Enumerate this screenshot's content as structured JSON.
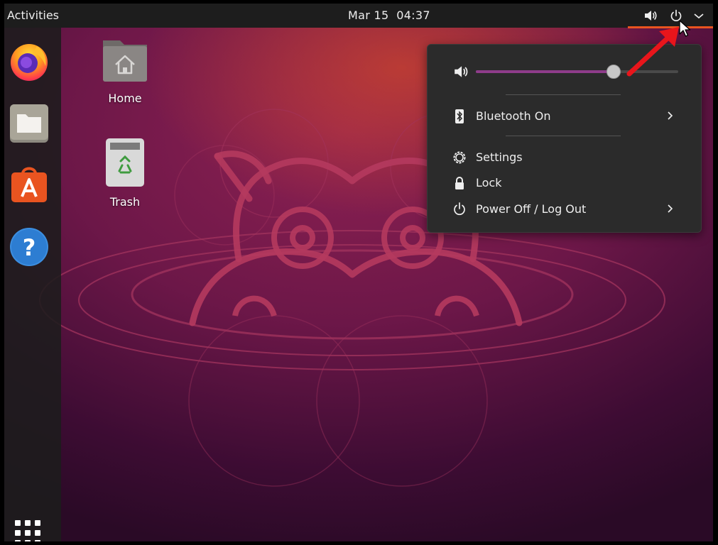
{
  "topbar": {
    "activities_label": "Activities",
    "date": "Mar 15",
    "time": "04:37",
    "icons": [
      "volume-icon",
      "power-icon",
      "chevron-down-icon"
    ]
  },
  "dock": {
    "items": [
      {
        "name": "Firefox",
        "icon": "firefox-icon"
      },
      {
        "name": "Files",
        "icon": "files-icon"
      },
      {
        "name": "Ubuntu Software",
        "icon": "software-icon"
      },
      {
        "name": "Help",
        "icon": "help-icon"
      }
    ],
    "show_apps_icon": "app-grid-icon"
  },
  "desktop": {
    "icons": [
      {
        "label": "Home",
        "icon": "home-folder-icon"
      },
      {
        "label": "Trash",
        "icon": "trash-icon"
      }
    ]
  },
  "system_menu": {
    "volume": {
      "icon": "volume-icon",
      "level": 0.68
    },
    "items": [
      {
        "label": "Bluetooth On",
        "icon": "bluetooth-icon",
        "has_submenu": true
      },
      {
        "label": "Settings",
        "icon": "settings-gear-icon",
        "has_submenu": false
      },
      {
        "label": "Lock",
        "icon": "lock-icon",
        "has_submenu": false
      },
      {
        "label": "Power Off / Log Out",
        "icon": "power-icon",
        "has_submenu": true
      }
    ]
  },
  "colors": {
    "accent": "#e95420",
    "slider_fill": "#8f3c8b",
    "topbar": "#1d1d1d",
    "menu_bg": "#2b2b2b",
    "annotation_arrow": "#e8151b"
  }
}
